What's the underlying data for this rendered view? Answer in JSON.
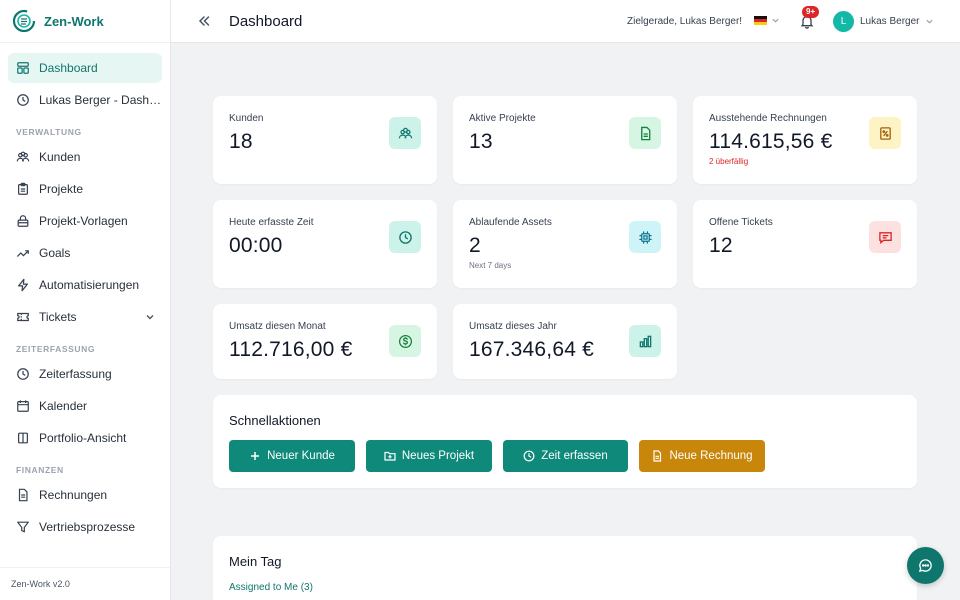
{
  "brand": {
    "name": "Zen-Work",
    "version": "Zen-Work v2.0"
  },
  "header": {
    "title": "Dashboard",
    "greeting": "Zielgerade, Lukas Berger!",
    "notification_count": "9+",
    "user_initial": "L",
    "user_name": "Lukas Berger"
  },
  "sidebar": {
    "items": [
      {
        "label": "Dashboard",
        "icon": "layout-icon",
        "active": true
      },
      {
        "label": "Lukas Berger - Dashboard",
        "icon": "clock-icon"
      }
    ],
    "sections": [
      {
        "title": "VERWALTUNG",
        "items": [
          {
            "label": "Kunden",
            "icon": "users-icon"
          },
          {
            "label": "Projekte",
            "icon": "clipboard-icon"
          },
          {
            "label": "Projekt-Vorlagen",
            "icon": "lock-icon"
          },
          {
            "label": "Goals",
            "icon": "trending-icon"
          },
          {
            "label": "Automatisierungen",
            "icon": "bolt-icon"
          },
          {
            "label": "Tickets",
            "icon": "ticket-icon"
          }
        ]
      },
      {
        "title": "ZEITERFASSUNG",
        "items": [
          {
            "label": "Zeiterfassung",
            "icon": "clock-icon"
          },
          {
            "label": "Kalender",
            "icon": "calendar-icon"
          },
          {
            "label": "Portfolio-Ansicht",
            "icon": "columns-icon"
          }
        ]
      },
      {
        "title": "FINANZEN",
        "items": [
          {
            "label": "Rechnungen",
            "icon": "file-icon"
          },
          {
            "label": "Vertriebsprozesse",
            "icon": "funnel-icon"
          }
        ]
      }
    ]
  },
  "stats": [
    {
      "label": "Kunden",
      "value": "18",
      "icon": "users-icon",
      "icon_bg": "#ccf2ea",
      "icon_color": "#0f766e"
    },
    {
      "label": "Aktive Projekte",
      "value": "13",
      "icon": "document-icon",
      "icon_bg": "#d6f5e3",
      "icon_color": "#15803d"
    },
    {
      "label": "Ausstehende Rechnungen",
      "value": "114.615,56 €",
      "sub": "2 überfällig",
      "icon": "receipt-icon",
      "icon_bg": "#fdf3c4",
      "icon_color": "#a16207"
    },
    {
      "label": "Heute erfasste Zeit",
      "value": "00:00",
      "icon": "clock-icon",
      "icon_bg": "#ccf2ea",
      "icon_color": "#0f766e"
    },
    {
      "label": "Ablaufende Assets",
      "value": "2",
      "sub": "Next 7 days",
      "icon": "chip-icon",
      "icon_bg": "#cff4f7",
      "icon_color": "#0e7490"
    },
    {
      "label": "Offene Tickets",
      "value": "12",
      "icon": "message-icon",
      "icon_bg": "#fde0e0",
      "icon_color": "#dc2626"
    },
    {
      "label": "Umsatz diesen Monat",
      "value": "112.716,00 €",
      "icon": "dollar-icon",
      "icon_bg": "#d6f5e3",
      "icon_color": "#15803d"
    },
    {
      "label": "Umsatz dieses Jahr",
      "value": "167.346,64 €",
      "icon": "bar-chart-icon",
      "icon_bg": "#ccf2ea",
      "icon_color": "#0f766e"
    }
  ],
  "quick_actions": {
    "title": "Schnellaktionen",
    "buttons": [
      {
        "label": "Neuer Kunde",
        "icon": "plus-icon",
        "color": "#0f8a7a"
      },
      {
        "label": "Neues Projekt",
        "icon": "folder-plus-icon",
        "color": "#0f8a7a"
      },
      {
        "label": "Zeit erfassen",
        "icon": "clock-icon",
        "color": "#0f8a7a"
      },
      {
        "label": "Neue Rechnung",
        "icon": "document-icon",
        "color": "#c8860b"
      }
    ]
  },
  "my_day": {
    "title": "Mein Tag",
    "tab": "Assigned to Me (3)"
  }
}
